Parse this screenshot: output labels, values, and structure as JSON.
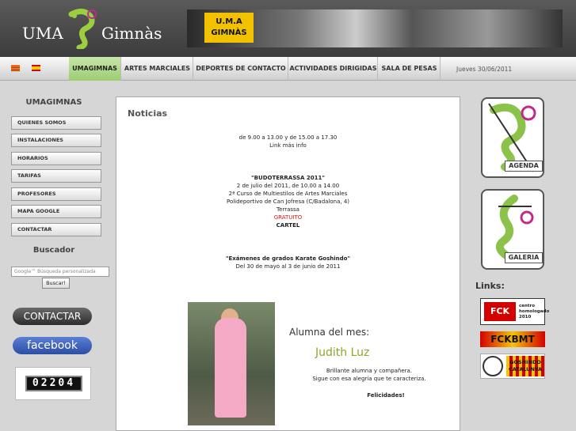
{
  "header": {
    "logo_left": "UMA",
    "logo_right": "Gimnàs",
    "banner_badge": "U.M.A GIMNÀS"
  },
  "nav": {
    "items": [
      {
        "label": "UMAGIMNAS",
        "active": true
      },
      {
        "label": "ARTES MARCIALES",
        "active": false
      },
      {
        "label": "DEPORTES DE CONTACTO",
        "active": false
      },
      {
        "label": "ACTIVIDADES DIRIGIDAS",
        "active": false
      },
      {
        "label": "SALA DE PESAS",
        "active": false
      }
    ],
    "date": "Jueves 30/06/2011"
  },
  "sidebar": {
    "title": "UMAGIMNAS",
    "items": [
      {
        "label": "QUIENES SOMOS"
      },
      {
        "label": "INSTALACIONES"
      },
      {
        "label": "HORARIOS"
      },
      {
        "label": "TARIFAS"
      },
      {
        "label": "PROFESORES"
      },
      {
        "label": "MAPA GOOGLE"
      },
      {
        "label": "CONTACTAR"
      }
    ],
    "search_title": "Buscador",
    "search_placeholder": "Google™ Búsqueda personalizada",
    "search_button": "Buscar!",
    "contact_button": "CONTACTAR",
    "facebook_button": "facebook",
    "counter": "02204"
  },
  "main": {
    "title": "Noticias",
    "lines": [
      {
        "text": "de 9.00 a 13.00 y de 15.00 a 17.30",
        "style": ""
      },
      {
        "text": "Link más info",
        "style": ""
      },
      {
        "text": "\"BUDOTERRASSA 2011\"",
        "style": "b"
      },
      {
        "text": "2 de julio del 2011, de 10.00 a 14.00",
        "style": ""
      },
      {
        "text": "2ª Curso de Multiestilos de Artes Marciales",
        "style": ""
      },
      {
        "text": "Polideportivo de Can Jofresa (C/Badalona, 4)",
        "style": ""
      },
      {
        "text": "Terrassa",
        "style": ""
      },
      {
        "text": "GRATUITO",
        "style": "red"
      },
      {
        "text": "CARTEL",
        "style": "b"
      },
      {
        "text": "\"Exámenes de grados Karate Goshindo\"",
        "style": "b"
      },
      {
        "text": "Del 30 de mayo al 3 de junio de 2011",
        "style": ""
      }
    ],
    "alumna_title": "Alumna del mes:",
    "alumna_name": "Judith Luz",
    "alumna_text1": "Brillante alumna y compañera.",
    "alumna_text2": "Sigue con esa alegría que te caracteriza.",
    "alumna_text3": "Felicidades!"
  },
  "rightbar": {
    "agenda_label": "AGENDA",
    "galeria_label": "GALERIA",
    "links_title": "Links:",
    "link1_title": "FCK",
    "link1_text": "centro homologado 2010",
    "link2_text": "FCKBMT",
    "link3_text": "GOSHINDO CATALUNYA"
  }
}
